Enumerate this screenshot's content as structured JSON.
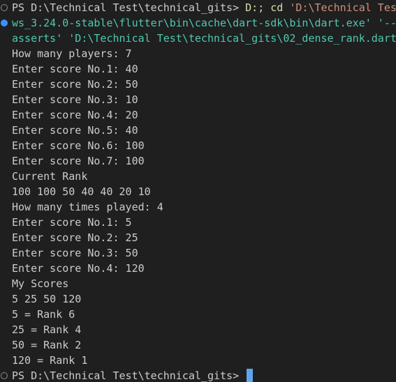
{
  "terminal": {
    "cmd": {
      "prompt": "PS D:\\Technical Test\\technical_gits> ",
      "drive": "D:;",
      "cd": "cd",
      "path_fragment": "'D:\\Technical Tes",
      "wrap1": "ws_3.24.0-stable\\flutter\\bin\\cache\\dart-sdk\\bin\\dart.exe' '--e",
      "wrap2": "asserts' 'D:\\Technical Test\\technical_gits\\02_dense_rank.dart"
    },
    "output": [
      "How many players: 7",
      "Enter score No.1: 40",
      "Enter score No.2: 50",
      "Enter score No.3: 10",
      "Enter score No.4: 20",
      "Enter score No.5: 40",
      "Enter score No.6: 100",
      "Enter score No.7: 100",
      "Current Rank",
      "100 100 50 40 40 20 10",
      "How many times played: 4",
      "Enter score No.1: 5",
      "Enter score No.2: 25",
      "Enter score No.3: 50",
      "Enter score No.4: 120",
      "My Scores",
      "5 25 50 120",
      "5 = Rank 6",
      "25 = Rank 4",
      "50 = Rank 2",
      "120 = Rank 1"
    ],
    "final_prompt": "PS D:\\Technical Test\\technical_gits> "
  },
  "colors": {
    "background": "#1f1f1f",
    "text": "#cccccc",
    "command_yellow": "#dcdcaa",
    "string_orange": "#ce9178",
    "wrapped_teal": "#4ec9b0",
    "decoration_blue": "#3794ff",
    "cursor": "#5ea5f0"
  }
}
